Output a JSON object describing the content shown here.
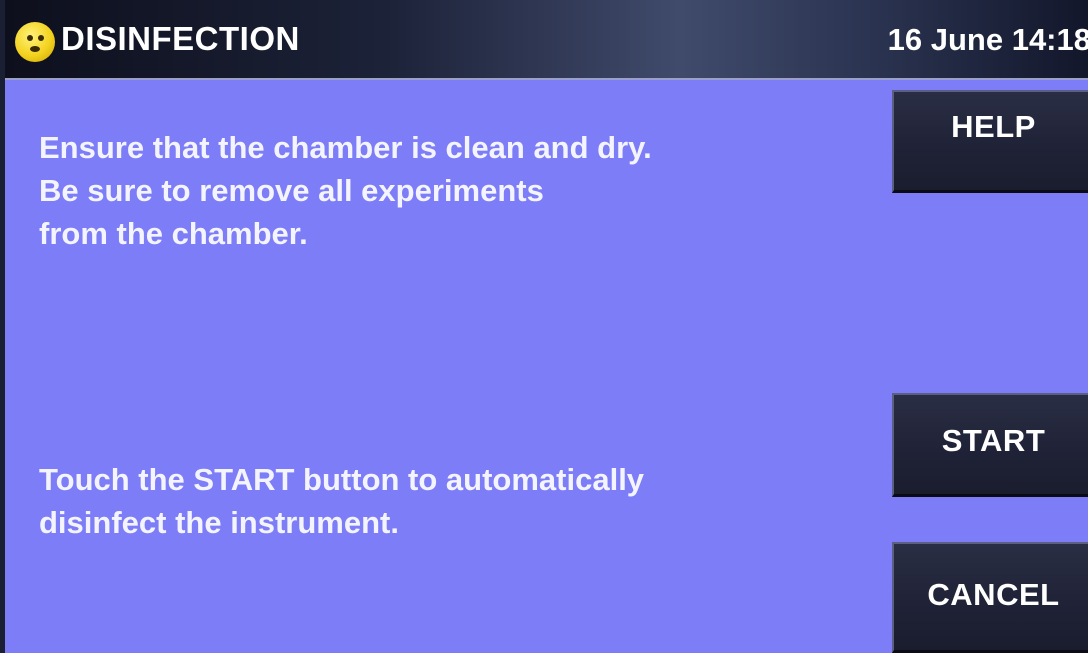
{
  "header": {
    "title": "DISINFECTION",
    "datetime": "16 June 14:18",
    "status_icon": "smiley-face-icon"
  },
  "instructions": {
    "prep_lines": [
      "Ensure that the chamber is clean and dry.",
      "Be sure to remove all experiments",
      "from the chamber."
    ],
    "start_lines": [
      "Touch the START button to automatically",
      "disinfect the instrument."
    ]
  },
  "buttons": {
    "help": "HELP",
    "start": "START",
    "cancel": "CANCEL"
  },
  "colors": {
    "background": "#7c7df7",
    "button": "#1f2236",
    "titlebar": "#1c2238",
    "text": "#ffffff"
  }
}
